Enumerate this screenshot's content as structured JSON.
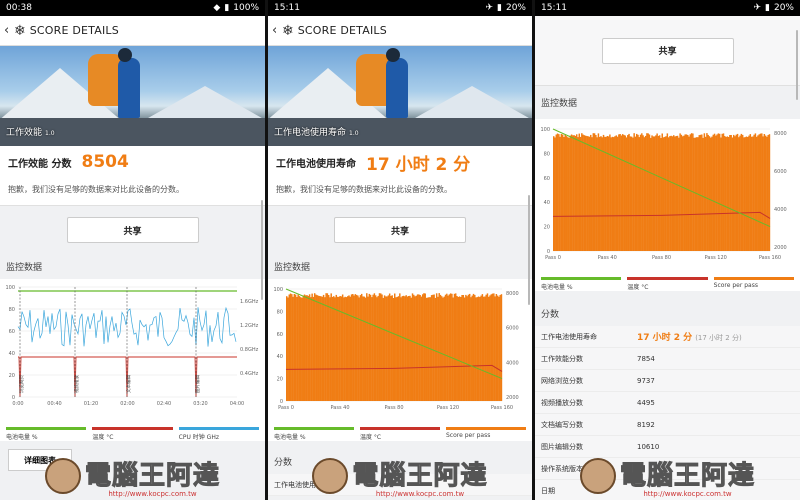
{
  "screens": [
    {
      "status": {
        "time": "00:38",
        "battery": "100%"
      },
      "appbar": {
        "back": "‹",
        "icon": "snowflake-icon",
        "title": "SCORE DETAILS"
      },
      "hero": {
        "caption": "工作效能",
        "version": "1.0"
      },
      "score": {
        "label": "工作效能 分数",
        "value": "8504"
      },
      "note": "抱歉，我们没有足够的数据来对比此设备的分数。",
      "share_label": "共享",
      "monitor_title": "监控数据",
      "legend": [
        "电池电量 %",
        "温度 °C",
        "CPU 时钟 GHz"
      ],
      "markers": [
        "浏览网页",
        "视频播放",
        "文本编辑",
        "图片编辑"
      ],
      "yticks": [
        "100",
        "80",
        "60",
        "40",
        "20",
        "0"
      ],
      "ryticks": [
        "1.6GHz",
        "1.2GHz",
        "0.8GHz",
        "0.4GHz"
      ],
      "xticks": [
        "0:00",
        "00:40",
        "01:20",
        "02:00",
        "02:40",
        "03:20",
        "04:00"
      ],
      "detail_label": "详细图表"
    },
    {
      "status": {
        "time": "15:11",
        "battery": "20%"
      },
      "appbar": {
        "back": "‹",
        "icon": "snowflake-icon",
        "title": "SCORE DETAILS"
      },
      "hero": {
        "caption": "工作电池使用寿命",
        "version": "1.0"
      },
      "score": {
        "label": "工作电池使用寿命",
        "value": "17 小时 2 分"
      },
      "note": "抱歉，我们没有足够的数据来对比此设备的分数。",
      "share_label": "共享",
      "monitor_title": "监控数据",
      "legend": [
        "电池电量 %",
        "温度 °C",
        "Score per pass"
      ],
      "yticks": [
        "100",
        "80",
        "60",
        "40",
        "20",
        "0"
      ],
      "ryticks": [
        "8000",
        "6000",
        "4000",
        "2000"
      ],
      "xticks": [
        "Pass 0",
        "Pass 40",
        "Pass 80",
        "Pass 120",
        "Pass 160"
      ],
      "scores_title": "分数",
      "scores_first": "工作电池使用寿命"
    },
    {
      "status": {
        "time": "15:11",
        "battery": "20%"
      },
      "share_label": "共享",
      "monitor_title": "监控数据",
      "legend": [
        "电池电量 %",
        "温度 °C",
        "Score per pass"
      ],
      "yticks": [
        "100",
        "80",
        "60",
        "40",
        "20",
        "0"
      ],
      "ryticks": [
        "8000",
        "6000",
        "4000",
        "2000"
      ],
      "xticks": [
        "Pass 0",
        "Pass 40",
        "Pass 80",
        "Pass 120",
        "Pass 160"
      ],
      "scores_title": "分数",
      "scores": [
        {
          "k": "工作电池使用寿命",
          "v": "17 小时 2 分",
          "sub": "(17 小时 2 分)"
        },
        {
          "k": "工作效能分数",
          "v": "7854"
        },
        {
          "k": "网络浏览分数",
          "v": "9737"
        },
        {
          "k": "视频播放分数",
          "v": "4495"
        },
        {
          "k": "文档编写分数",
          "v": "8192"
        },
        {
          "k": "图片编辑分数",
          "v": "10610"
        },
        {
          "k": "操作系统版本",
          "v": "1"
        },
        {
          "k": "日期",
          "v": ""
        }
      ]
    }
  ],
  "colors": {
    "accent": "#f07d14",
    "battery": "#66bb2a",
    "temp": "#c8332a",
    "cpu": "#3aa6dc",
    "score": "#f07d14"
  },
  "watermark": {
    "text": "電腦王阿達",
    "url": "http://www.kocpc.com.tw"
  }
}
